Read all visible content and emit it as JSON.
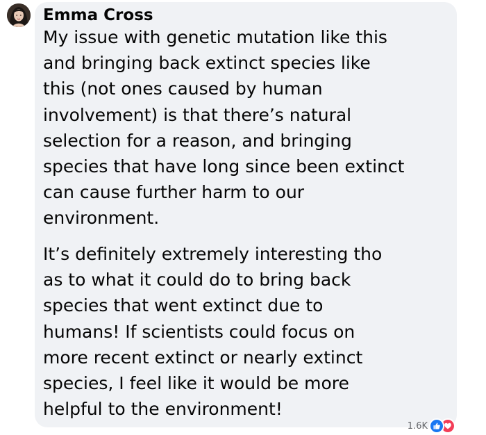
{
  "comment": {
    "author": "Emma Cross",
    "paragraphs": [
      {
        "lines": [
          "My issue with genetic mutation like this",
          "and bringing back extinct species like",
          "this (not ones caused by human",
          "involvement) is that there’s natural",
          "selection for a reason, and bringing",
          "species that have long since been extinct",
          "can cause further harm to our",
          "environment."
        ]
      },
      {
        "lines": [
          "It’s definitely extremely interesting tho",
          "as to what it could do to bring back",
          "species that went extinct due to",
          "humans! If scientists could focus on",
          "more recent extinct or nearly extinct",
          "species, I feel like it would be more",
          "helpful to the environment!"
        ]
      }
    ],
    "reactions": {
      "count": "1.6K",
      "icons": [
        "like-icon",
        "love-icon"
      ],
      "colors": {
        "like": "#1877f2",
        "love": "#f33e58"
      }
    }
  },
  "colors": {
    "bubble": "#f0f2f5",
    "text": "#050505",
    "muted": "#65676b"
  }
}
